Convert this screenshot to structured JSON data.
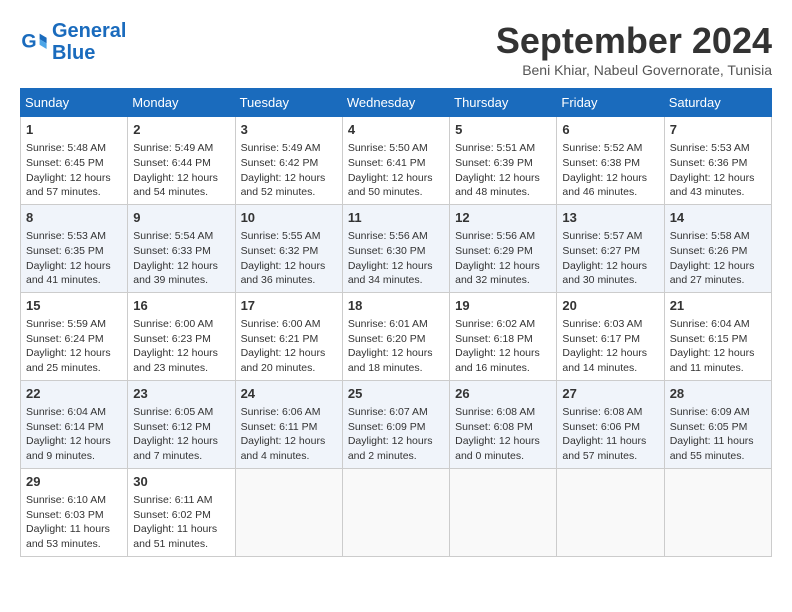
{
  "header": {
    "logo_line1": "General",
    "logo_line2": "Blue",
    "month_title": "September 2024",
    "location": "Beni Khiar, Nabeul Governorate, Tunisia"
  },
  "weekdays": [
    "Sunday",
    "Monday",
    "Tuesday",
    "Wednesday",
    "Thursday",
    "Friday",
    "Saturday"
  ],
  "weeks": [
    [
      {
        "day": 1,
        "info": "Sunrise: 5:48 AM\nSunset: 6:45 PM\nDaylight: 12 hours\nand 57 minutes."
      },
      {
        "day": 2,
        "info": "Sunrise: 5:49 AM\nSunset: 6:44 PM\nDaylight: 12 hours\nand 54 minutes."
      },
      {
        "day": 3,
        "info": "Sunrise: 5:49 AM\nSunset: 6:42 PM\nDaylight: 12 hours\nand 52 minutes."
      },
      {
        "day": 4,
        "info": "Sunrise: 5:50 AM\nSunset: 6:41 PM\nDaylight: 12 hours\nand 50 minutes."
      },
      {
        "day": 5,
        "info": "Sunrise: 5:51 AM\nSunset: 6:39 PM\nDaylight: 12 hours\nand 48 minutes."
      },
      {
        "day": 6,
        "info": "Sunrise: 5:52 AM\nSunset: 6:38 PM\nDaylight: 12 hours\nand 46 minutes."
      },
      {
        "day": 7,
        "info": "Sunrise: 5:53 AM\nSunset: 6:36 PM\nDaylight: 12 hours\nand 43 minutes."
      }
    ],
    [
      {
        "day": 8,
        "info": "Sunrise: 5:53 AM\nSunset: 6:35 PM\nDaylight: 12 hours\nand 41 minutes."
      },
      {
        "day": 9,
        "info": "Sunrise: 5:54 AM\nSunset: 6:33 PM\nDaylight: 12 hours\nand 39 minutes."
      },
      {
        "day": 10,
        "info": "Sunrise: 5:55 AM\nSunset: 6:32 PM\nDaylight: 12 hours\nand 36 minutes."
      },
      {
        "day": 11,
        "info": "Sunrise: 5:56 AM\nSunset: 6:30 PM\nDaylight: 12 hours\nand 34 minutes."
      },
      {
        "day": 12,
        "info": "Sunrise: 5:56 AM\nSunset: 6:29 PM\nDaylight: 12 hours\nand 32 minutes."
      },
      {
        "day": 13,
        "info": "Sunrise: 5:57 AM\nSunset: 6:27 PM\nDaylight: 12 hours\nand 30 minutes."
      },
      {
        "day": 14,
        "info": "Sunrise: 5:58 AM\nSunset: 6:26 PM\nDaylight: 12 hours\nand 27 minutes."
      }
    ],
    [
      {
        "day": 15,
        "info": "Sunrise: 5:59 AM\nSunset: 6:24 PM\nDaylight: 12 hours\nand 25 minutes."
      },
      {
        "day": 16,
        "info": "Sunrise: 6:00 AM\nSunset: 6:23 PM\nDaylight: 12 hours\nand 23 minutes."
      },
      {
        "day": 17,
        "info": "Sunrise: 6:00 AM\nSunset: 6:21 PM\nDaylight: 12 hours\nand 20 minutes."
      },
      {
        "day": 18,
        "info": "Sunrise: 6:01 AM\nSunset: 6:20 PM\nDaylight: 12 hours\nand 18 minutes."
      },
      {
        "day": 19,
        "info": "Sunrise: 6:02 AM\nSunset: 6:18 PM\nDaylight: 12 hours\nand 16 minutes."
      },
      {
        "day": 20,
        "info": "Sunrise: 6:03 AM\nSunset: 6:17 PM\nDaylight: 12 hours\nand 14 minutes."
      },
      {
        "day": 21,
        "info": "Sunrise: 6:04 AM\nSunset: 6:15 PM\nDaylight: 12 hours\nand 11 minutes."
      }
    ],
    [
      {
        "day": 22,
        "info": "Sunrise: 6:04 AM\nSunset: 6:14 PM\nDaylight: 12 hours\nand 9 minutes."
      },
      {
        "day": 23,
        "info": "Sunrise: 6:05 AM\nSunset: 6:12 PM\nDaylight: 12 hours\nand 7 minutes."
      },
      {
        "day": 24,
        "info": "Sunrise: 6:06 AM\nSunset: 6:11 PM\nDaylight: 12 hours\nand 4 minutes."
      },
      {
        "day": 25,
        "info": "Sunrise: 6:07 AM\nSunset: 6:09 PM\nDaylight: 12 hours\nand 2 minutes."
      },
      {
        "day": 26,
        "info": "Sunrise: 6:08 AM\nSunset: 6:08 PM\nDaylight: 12 hours\nand 0 minutes."
      },
      {
        "day": 27,
        "info": "Sunrise: 6:08 AM\nSunset: 6:06 PM\nDaylight: 11 hours\nand 57 minutes."
      },
      {
        "day": 28,
        "info": "Sunrise: 6:09 AM\nSunset: 6:05 PM\nDaylight: 11 hours\nand 55 minutes."
      }
    ],
    [
      {
        "day": 29,
        "info": "Sunrise: 6:10 AM\nSunset: 6:03 PM\nDaylight: 11 hours\nand 53 minutes."
      },
      {
        "day": 30,
        "info": "Sunrise: 6:11 AM\nSunset: 6:02 PM\nDaylight: 11 hours\nand 51 minutes."
      },
      null,
      null,
      null,
      null,
      null
    ]
  ]
}
